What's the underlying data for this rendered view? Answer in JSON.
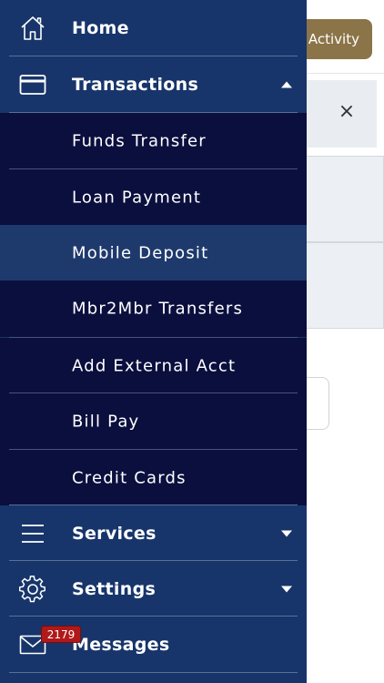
{
  "background": {
    "activity_label": "Activity",
    "close_glyph": "×"
  },
  "nav": {
    "home": {
      "label": "Home",
      "icon": "home-icon"
    },
    "transactions": {
      "label": "Transactions",
      "icon": "card-icon",
      "expanded": true
    },
    "sub_items": [
      {
        "label": "Funds Transfer"
      },
      {
        "label": "Loan Payment"
      },
      {
        "label": "Mobile Deposit",
        "active": true
      },
      {
        "label": "Mbr2Mbr Transfers"
      },
      {
        "label": "Add External Acct"
      },
      {
        "label": "Bill Pay"
      },
      {
        "label": "Credit Cards"
      }
    ],
    "services": {
      "label": "Services",
      "icon": "menu-icon"
    },
    "settings": {
      "label": "Settings",
      "icon": "gear-icon"
    },
    "messages": {
      "label": "Messages",
      "icon": "envelope-icon",
      "badge": "2179"
    }
  },
  "colors": {
    "drawer_bg": "#17356b",
    "submenu_bg": "#0b0f3e",
    "active_bg": "#1e3a6d",
    "badge_bg": "#b01919",
    "activity_btn": "#8b7448"
  }
}
